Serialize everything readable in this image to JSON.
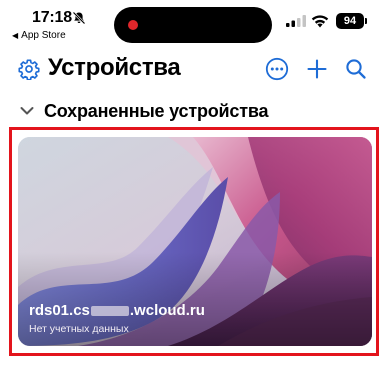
{
  "status": {
    "time": "17:18",
    "back_label": "App Store",
    "battery": "94"
  },
  "nav": {
    "title": "Устройства"
  },
  "section": {
    "title": "Сохраненные устройства"
  },
  "devices": [
    {
      "name_prefix": "rds01.cs",
      "name_suffix": ".wcloud.ru",
      "subtitle": "Нет учетных данных"
    }
  ],
  "colors": {
    "accent": "#1e6cd6",
    "selection": "#e3141c"
  },
  "icons": [
    "bell-slash-icon",
    "signal-icon",
    "wifi-icon",
    "battery-icon",
    "gear-icon",
    "more-icon",
    "plus-icon",
    "search-icon",
    "chevron-down-icon"
  ]
}
